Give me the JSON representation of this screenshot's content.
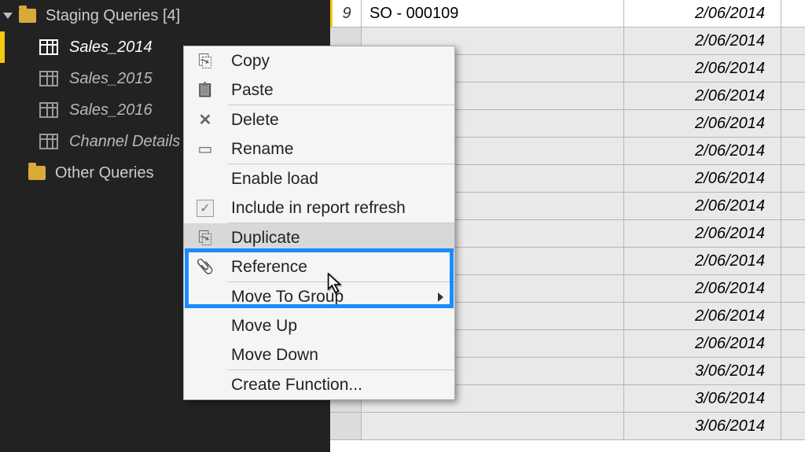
{
  "sidebar": {
    "group1": {
      "label": "Staging Queries [4]"
    },
    "items": [
      {
        "label": "Sales_2014",
        "selected": true
      },
      {
        "label": "Sales_2015",
        "selected": false
      },
      {
        "label": "Sales_2016",
        "selected": false
      },
      {
        "label": "Channel Details",
        "selected": false
      }
    ],
    "group2": {
      "label": "Other Queries"
    }
  },
  "grid": {
    "rows": [
      {
        "n": "9",
        "col1": "SO - 000109",
        "col2": "2/06/2014"
      },
      {
        "n": "",
        "col1": "",
        "col2": "2/06/2014"
      },
      {
        "n": "",
        "col1": "",
        "col2": "2/06/2014"
      },
      {
        "n": "",
        "col1": "",
        "col2": "2/06/2014"
      },
      {
        "n": "",
        "col1": "",
        "col2": "2/06/2014"
      },
      {
        "n": "",
        "col1": "",
        "col2": "2/06/2014"
      },
      {
        "n": "",
        "col1": "",
        "col2": "2/06/2014"
      },
      {
        "n": "",
        "col1": "",
        "col2": "2/06/2014"
      },
      {
        "n": "",
        "col1": "",
        "col2": "2/06/2014"
      },
      {
        "n": "",
        "col1": "",
        "col2": "2/06/2014"
      },
      {
        "n": "",
        "col1": "",
        "col2": "2/06/2014"
      },
      {
        "n": "",
        "col1": "",
        "col2": "2/06/2014"
      },
      {
        "n": "",
        "col1": "",
        "col2": "2/06/2014"
      },
      {
        "n": "",
        "col1": "",
        "col2": "3/06/2014"
      },
      {
        "n": "",
        "col1": "",
        "col2": "3/06/2014"
      },
      {
        "n": "",
        "col1": "",
        "col2": "3/06/2014"
      }
    ]
  },
  "menu": {
    "copy": "Copy",
    "paste": "Paste",
    "delete": "Delete",
    "rename": "Rename",
    "enable_load": "Enable load",
    "include_refresh": "Include in report refresh",
    "duplicate": "Duplicate",
    "reference": "Reference",
    "move_to_group": "Move To Group",
    "move_up": "Move Up",
    "move_down": "Move Down",
    "create_function": "Create Function..."
  }
}
